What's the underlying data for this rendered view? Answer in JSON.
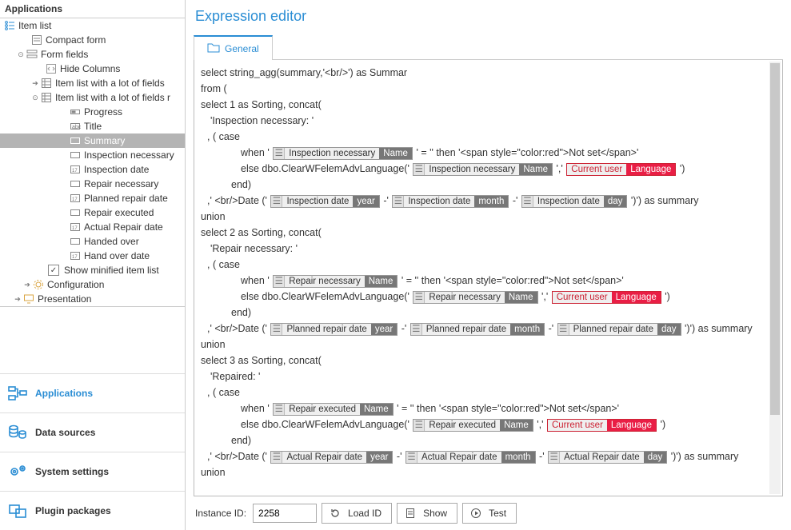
{
  "sidebar": {
    "header": "Applications",
    "root": "Item list",
    "compactForm": "Compact form",
    "formFields": "Form fields",
    "hideColumns": "Hide Columns",
    "itemListLot1": "Item list with a lot of fields",
    "itemListLot2": "Item list with a lot of fields r",
    "fields": {
      "progress": "Progress",
      "title": "Title",
      "summary": "Summary",
      "inspectionNecessary": "Inspection necessary",
      "inspectionDate": "Inspection date",
      "repairNecessary": "Repair necessary",
      "plannedRepairDate": "Planned repair date",
      "repairExecuted": "Repair executed",
      "actualRepairDate": "Actual Repair date",
      "handedOver": "Handed over",
      "handOverDate": "Hand over date"
    },
    "showMinified": "Show minified item list",
    "configuration": "Configuration",
    "presentation": "Presentation"
  },
  "nav": {
    "applications": "Applications",
    "dataSources": "Data sources",
    "systemSettings": "System settings",
    "pluginPackages": "Plugin packages"
  },
  "main": {
    "title": "Expression editor",
    "tab": "General"
  },
  "code": {
    "s01": "select string_agg(summary,'<br/>') as Summar",
    "s02": "from (",
    "s03": "select 1 as Sorting, concat(",
    "s04": "'Inspection necessary: '",
    "s05": ", ( case",
    "s06a": "when '",
    "s06b": "'  = '' then  '<span style=\"color:red\">Not set</span>'",
    "s07a": "else dbo.ClearWFelemAdvLanguage('",
    "s07b": "','",
    "s07c": "')",
    "s08": "end)",
    "s09a": ",' <br/>Date ('",
    "s09dash": "-'",
    "s09end": "')') as summary",
    "s10": "union",
    "s11": "select 2 as Sorting, concat(",
    "s12": "'Repair necessary: '",
    "s15": "select 3 as Sorting, concat(",
    "s16": "'Repaired: '"
  },
  "tokens": {
    "inspNecName": {
      "label": "Inspection necessary",
      "part": "Name"
    },
    "currentUserLang": {
      "label": "Current user",
      "part": "Language"
    },
    "inspDateYear": {
      "label": "Inspection date",
      "part": "year"
    },
    "inspDateMonth": {
      "label": "Inspection date",
      "part": "month"
    },
    "inspDateDay": {
      "label": "Inspection date",
      "part": "day"
    },
    "repNecName": {
      "label": "Repair necessary",
      "part": "Name"
    },
    "planDateYear": {
      "label": "Planned repair date",
      "part": "year"
    },
    "planDateMonth": {
      "label": "Planned repair date",
      "part": "month"
    },
    "planDateDay": {
      "label": "Planned repair date",
      "part": "day"
    },
    "repExecName": {
      "label": "Repair executed",
      "part": "Name"
    },
    "actDateYear": {
      "label": "Actual Repair date",
      "part": "year"
    },
    "actDateMonth": {
      "label": "Actual Repair date",
      "part": "month"
    },
    "actDateDay": {
      "label": "Actual Repair date",
      "part": "day"
    }
  },
  "footer": {
    "instanceLabel": "Instance ID:",
    "instanceValue": "2258",
    "loadId": "Load ID",
    "show": "Show",
    "test": "Test"
  }
}
